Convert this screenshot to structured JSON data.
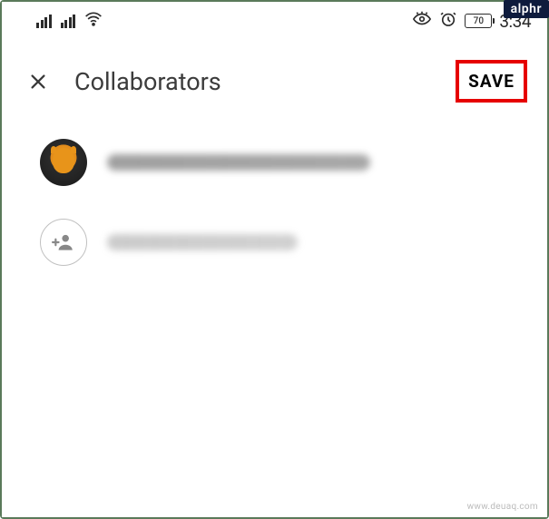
{
  "status_bar": {
    "battery_level": "70",
    "time": "3:34"
  },
  "badge": {
    "label": "alphr"
  },
  "header": {
    "title": "Collaborators",
    "save_label": "SAVE"
  },
  "collaborators": [
    {
      "type": "user",
      "email_obscured": true
    },
    {
      "type": "add",
      "email_obscured": true
    }
  ],
  "watermark": "www.deuaq.com",
  "icons": {
    "close": "close-icon",
    "signal": "signal-icon",
    "wifi": "wifi-icon",
    "eye": "visibility-icon",
    "alarm": "alarm-icon",
    "battery": "battery-icon",
    "add_person": "add-person-icon"
  },
  "colors": {
    "highlight_border": "#e60000",
    "frame_border": "#5a7a5a",
    "text_primary": "#3c3c3c",
    "badge_bg": "#0e1b3d"
  }
}
